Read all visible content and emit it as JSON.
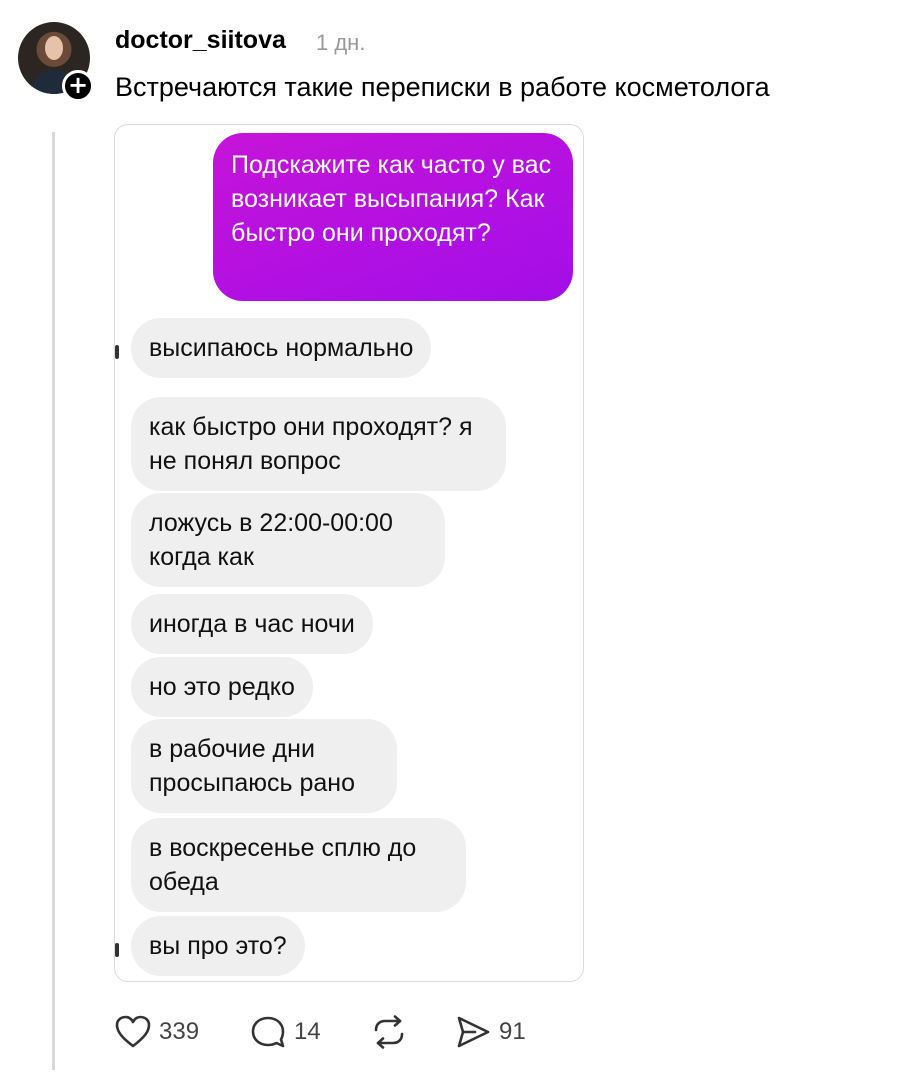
{
  "post": {
    "username": "doctor_siitova",
    "time": "1 дн.",
    "text": "Встречаются такие переписки в работе косметолога",
    "follow_symbol": "+"
  },
  "chat": {
    "outgoing": [
      "Подскажите как часто у вас возникает высыпания?  Как быстро они проходят?"
    ],
    "incoming": [
      "высипаюсь нормально",
      "как быстро они проходят? я не понял вопрос",
      "ложусь в 22:00-00:00 когда как",
      "иногда в час ночи",
      "но это редко",
      "в рабочие дни просыпаюсь рано",
      "в воскресенье сплю до обеда",
      "вы про это?"
    ]
  },
  "actions": {
    "likes": "339",
    "comments": "14",
    "shares": "91"
  },
  "icons": {
    "like": "heart-icon",
    "comment": "comment-icon",
    "repost": "repost-icon",
    "share": "send-icon"
  },
  "colors": {
    "outgoing_bubble": "#b812de",
    "incoming_bubble": "#efefef",
    "time": "#999999"
  }
}
